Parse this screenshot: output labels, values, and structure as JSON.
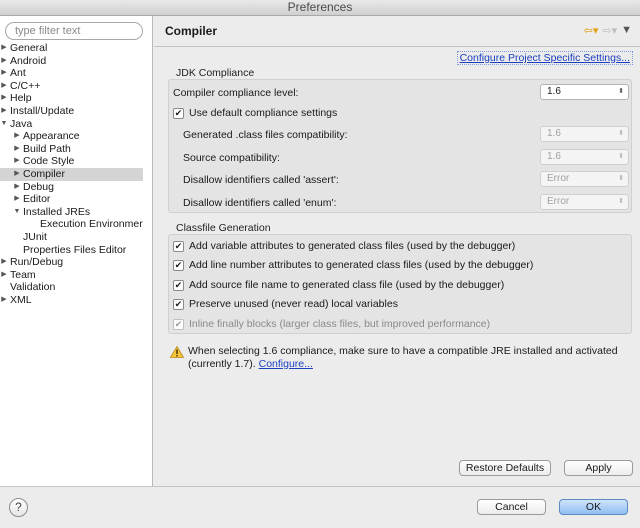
{
  "window": {
    "title": "Preferences"
  },
  "sidebar": {
    "filter_placeholder": "type filter text",
    "items": [
      {
        "label": "General",
        "arrow": "▶",
        "level": 0
      },
      {
        "label": "Android",
        "arrow": "▶",
        "level": 0
      },
      {
        "label": "Ant",
        "arrow": "▶",
        "level": 0
      },
      {
        "label": "C/C++",
        "arrow": "▶",
        "level": 0
      },
      {
        "label": "Help",
        "arrow": "▶",
        "level": 0
      },
      {
        "label": "Install/Update",
        "arrow": "▶",
        "level": 0
      },
      {
        "label": "Java",
        "arrow": "▼",
        "level": 0
      },
      {
        "label": "Appearance",
        "arrow": "▶",
        "level": 1
      },
      {
        "label": "Build Path",
        "arrow": "▶",
        "level": 1
      },
      {
        "label": "Code Style",
        "arrow": "▶",
        "level": 1
      },
      {
        "label": "Compiler",
        "arrow": "▶",
        "level": 1,
        "selected": true
      },
      {
        "label": "Debug",
        "arrow": "▶",
        "level": 1
      },
      {
        "label": "Editor",
        "arrow": "▶",
        "level": 1
      },
      {
        "label": "Installed JREs",
        "arrow": "▼",
        "level": 1
      },
      {
        "label": "Execution Environmer",
        "arrow": "",
        "level": 2
      },
      {
        "label": "JUnit",
        "arrow": "",
        "level": 1
      },
      {
        "label": "Properties Files Editor",
        "arrow": "",
        "level": 1
      },
      {
        "label": "Run/Debug",
        "arrow": "▶",
        "level": 0
      },
      {
        "label": "Team",
        "arrow": "▶",
        "level": 0
      },
      {
        "label": "Validation",
        "arrow": "",
        "level": 0
      },
      {
        "label": "XML",
        "arrow": "▶",
        "level": 0
      }
    ]
  },
  "page": {
    "title": "Compiler",
    "configure_link": "Configure Project Specific Settings...",
    "nav_icons": [
      "back-arrow-icon",
      "forward-arrow-icon",
      "view-menu-icon"
    ]
  },
  "jdk": {
    "group_title": "JDK Compliance",
    "compliance_label": "Compiler compliance level:",
    "compliance_value": "1.6",
    "use_default_label": "Use default compliance settings",
    "use_default_checked": true,
    "rows": [
      {
        "label": "Generated .class files compatibility:",
        "value": "1.6"
      },
      {
        "label": "Source compatibility:",
        "value": "1.6"
      },
      {
        "label": "Disallow identifiers called 'assert':",
        "value": "Error"
      },
      {
        "label": "Disallow identifiers called 'enum':",
        "value": "Error"
      }
    ]
  },
  "classfile": {
    "group_title": "Classfile Generation",
    "options": [
      {
        "label": "Add variable attributes to generated class files (used by the debugger)",
        "checked": true,
        "disabled": false
      },
      {
        "label": "Add line number attributes to generated class files (used by the debugger)",
        "checked": true,
        "disabled": false
      },
      {
        "label": "Add source file name to generated class file (used by the debugger)",
        "checked": true,
        "disabled": false
      },
      {
        "label": "Preserve unused (never read) local variables",
        "checked": true,
        "disabled": false
      },
      {
        "label": "Inline finally blocks (larger class files, but improved performance)",
        "checked": true,
        "disabled": true
      }
    ]
  },
  "warning": {
    "text": "When selecting 1.6 compliance, make sure to have a compatible JRE installed and activated (currently 1.7).",
    "link": "Configure..."
  },
  "buttons": {
    "restore_defaults": "Restore Defaults",
    "apply": "Apply",
    "cancel": "Cancel",
    "ok": "OK"
  },
  "help_glyph": "?",
  "check_glyph": "✔"
}
